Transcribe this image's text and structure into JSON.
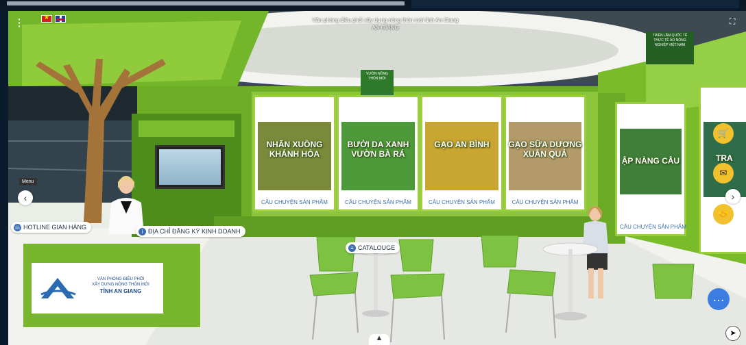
{
  "header": {
    "title_line1": "Văn phòng điều phối xây dựng nông thôn mới tỉnh An Giang",
    "title_line2": "AN GIANG"
  },
  "booth": {
    "banner_left": "VƯỜN NÔNG THÔN MỚI",
    "banner_right": "TRIỂN LÃM QUỐC TẾ THỰC TẾ ẢO NÔNG NGHIỆP VIỆT NAM"
  },
  "products": [
    {
      "name": "NHÃN XUỒNG KHÁNH HÒA",
      "story": "CÂU CHUYỆN SẢN PHẨM",
      "color": "#7a8a3a"
    },
    {
      "name": "BƯỞI DA XANH VƯỜN BÀ RÁ",
      "story": "CÂU CHUYỆN SẢN PHẨM",
      "color": "#4e9a3a"
    },
    {
      "name": "GẠO AN BÌNH",
      "story": "CÂU CHUYỆN SẢN PHẨM",
      "color": "#c9a531"
    },
    {
      "name": "GẠO SỮA DƯƠNG XUÂN QUẢ",
      "story": "CÂU CHUYỆN SẢN PHẨM",
      "color": "#b39a6a"
    },
    {
      "name": "ẬP NÀNG CÂU",
      "story": "CÂU CHUYỆN SẢN PHẨM",
      "color": "#3f7f3a"
    },
    {
      "name": "TRA",
      "story": "",
      "color": "#2f6d4a"
    }
  ],
  "buttons": {
    "hotline": "HOTLINE GIAN HÀNG",
    "address": "ĐỊA CHỈ ĐĂNG KÝ KINH DOANH",
    "catalogue": "CATALOUGE",
    "menu": "Menu"
  },
  "desk": {
    "line1": "VĂN PHÒNG ĐIỀU PHỐI",
    "line2": "XÂY DỰNG NÔNG THÔN MỚI",
    "line3": "TỈNH AN GIANG"
  },
  "icons": {
    "cart": "cart-icon",
    "mail": "mail-icon",
    "handshake": "handshake-icon",
    "chat": "chat-icon"
  }
}
